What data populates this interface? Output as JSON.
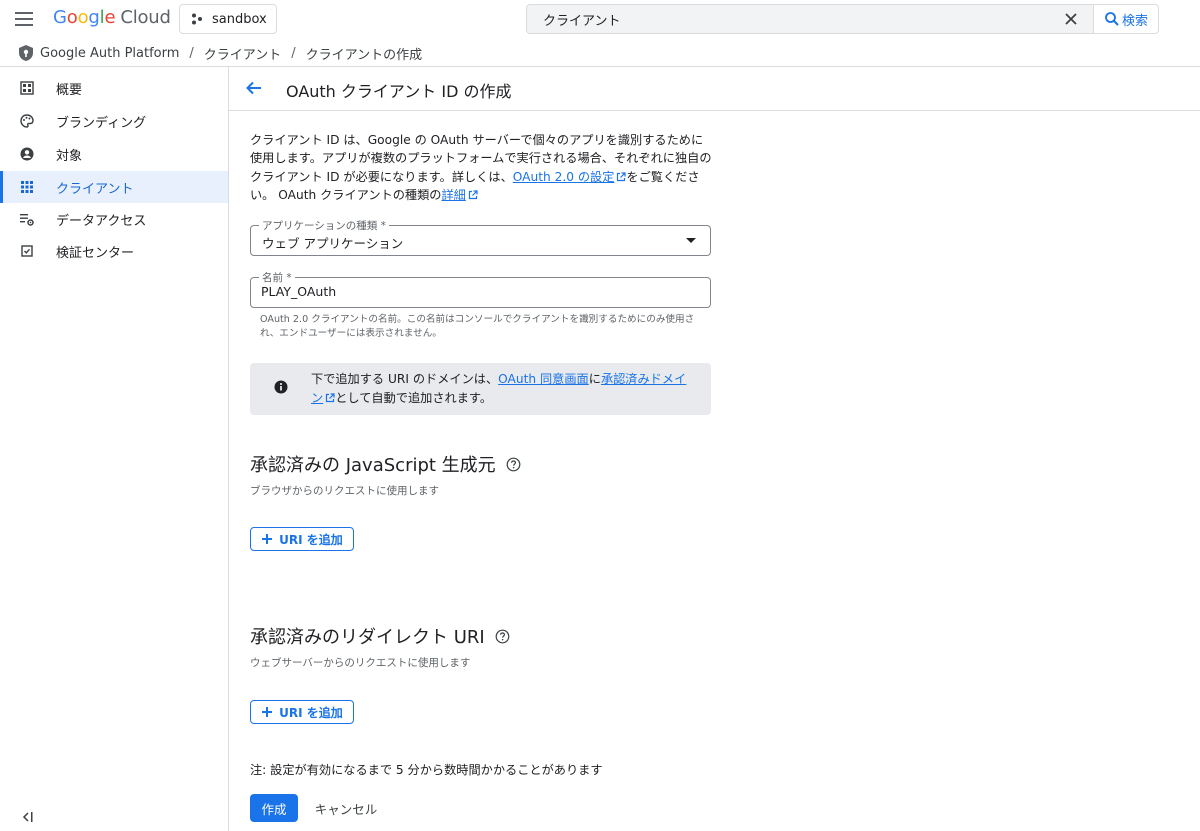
{
  "header": {
    "logo_google": "Google",
    "logo_cloud": "Cloud",
    "project": "sandbox",
    "search": {
      "value": "クライアント",
      "button_label": "検索"
    }
  },
  "breadcrumb": [
    "Google Auth Platform",
    "クライアント",
    "クライアントの作成"
  ],
  "sidebar": {
    "items": [
      {
        "label": "概要",
        "icon": "dashboard-icon",
        "active": false
      },
      {
        "label": "ブランディング",
        "icon": "palette-icon",
        "active": false
      },
      {
        "label": "対象",
        "icon": "account-circle-icon",
        "active": false
      },
      {
        "label": "クライアント",
        "icon": "apps-grid-icon",
        "active": true
      },
      {
        "label": "データアクセス",
        "icon": "data-settings-icon",
        "active": false
      },
      {
        "label": "検証センター",
        "icon": "check-box-icon",
        "active": false
      }
    ]
  },
  "page": {
    "title": "OAuth クライアント ID の作成",
    "intro": {
      "part1": "クライアント ID は、Google の OAuth サーバーで個々のアプリを識別するために使用します。アプリが複数のプラットフォームで実行される場合、それぞれに独自のクライアント ID が必要になります。詳しくは、",
      "link1": "OAuth 2.0 の設定",
      "part2": "をご覧ください。 OAuth クライアントの種類の",
      "link2": "詳細"
    },
    "app_type": {
      "label": "アプリケーションの種類 *",
      "value": "ウェブ アプリケーション"
    },
    "name": {
      "label": "名前 *",
      "value": "PLAY_OAuth",
      "helper": "OAuth 2.0 クライアントの名前。この名前はコンソールでクライアントを識別するためにのみ使用され、エンドユーザーには表示されません。"
    },
    "info_banner": {
      "part1": "下で追加する URI のドメインは、",
      "link1": "OAuth 同意画面",
      "part2": "に",
      "link2": "承認済みドメイン",
      "part3": "として自動で追加されます。"
    },
    "js_origins": {
      "title": "承認済みの JavaScript 生成元",
      "subtitle": "ブラウザからのリクエストに使用します",
      "add_button": "URI を追加"
    },
    "redirect_uris": {
      "title": "承認済みのリダイレクト URI",
      "subtitle": "ウェブサーバーからのリクエストに使用します",
      "add_button": "URI を追加"
    },
    "note": "注: 設定が有効になるまで 5 分から数時間かかることがあります",
    "create_button": "作成",
    "cancel_button": "キャンセル"
  },
  "colors": {
    "accent": "#1a73e8",
    "active_nav_bg": "#e8f0fe",
    "banner_bg": "#e8eaed"
  }
}
